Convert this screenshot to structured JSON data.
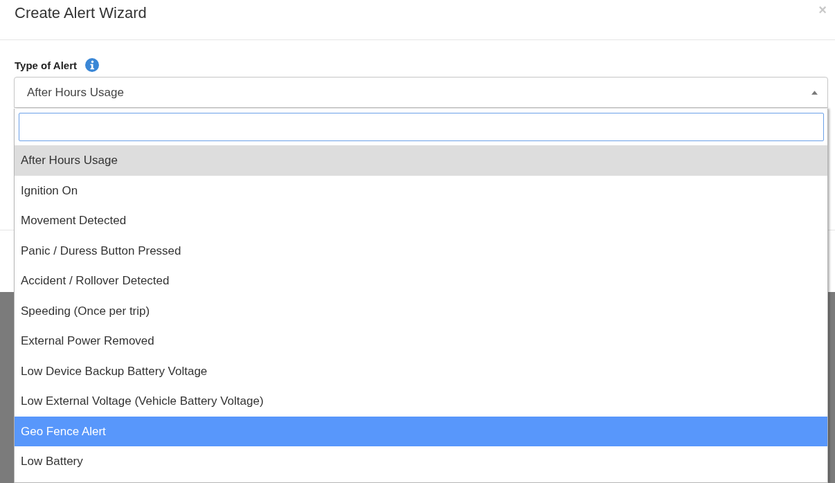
{
  "dialog": {
    "title": "Create Alert Wizard",
    "close": "×"
  },
  "field": {
    "label": "Type of Alert",
    "value": "After Hours Usage",
    "expanded": true
  },
  "dropdown": {
    "options": [
      {
        "label": "After Hours Usage",
        "selected": true,
        "highlighted": false
      },
      {
        "label": "Ignition On",
        "selected": false,
        "highlighted": false
      },
      {
        "label": "Movement Detected",
        "selected": false,
        "highlighted": false
      },
      {
        "label": "Panic / Duress Button Pressed",
        "selected": false,
        "highlighted": false
      },
      {
        "label": "Accident / Rollover Detected",
        "selected": false,
        "highlighted": false
      },
      {
        "label": "Speeding (Once per trip)",
        "selected": false,
        "highlighted": false
      },
      {
        "label": "External Power Removed",
        "selected": false,
        "highlighted": false
      },
      {
        "label": "Low Device Backup Battery Voltage",
        "selected": false,
        "highlighted": false
      },
      {
        "label": "Low External Voltage (Vehicle Battery Voltage)",
        "selected": false,
        "highlighted": false
      },
      {
        "label": "Geo Fence Alert",
        "selected": false,
        "highlighted": true
      },
      {
        "label": "Low Battery",
        "selected": false,
        "highlighted": false
      }
    ]
  }
}
